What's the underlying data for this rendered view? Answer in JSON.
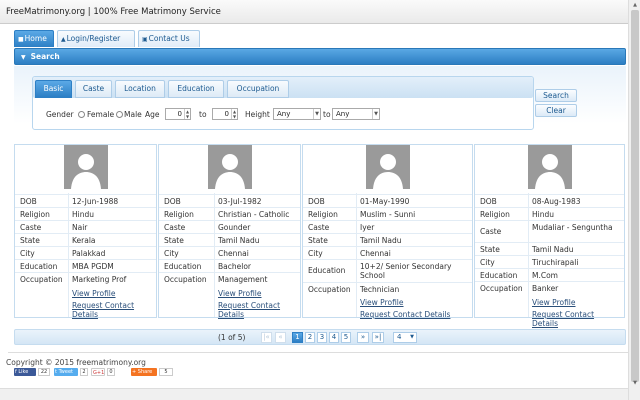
{
  "site": {
    "title": "FreeMatrimony.org | 100% Free Matrimony Service"
  },
  "nav": {
    "tabs": [
      {
        "label": "Home",
        "icon": "home-icon"
      },
      {
        "label": "Login/Register",
        "icon": "lock-icon"
      },
      {
        "label": "Contact Us",
        "icon": "mail-icon"
      }
    ]
  },
  "search": {
    "header": "Search",
    "tabs": [
      "Basic",
      "Caste",
      "Location",
      "Education",
      "Occupation"
    ],
    "gender_label": "Gender",
    "female_label": "Female",
    "male_label": "Male",
    "age_label": "Age",
    "age_from": "0",
    "age_to_label": "to",
    "age_to": "0",
    "height_label": "Height",
    "height_from": "Any",
    "height_to_label": "to",
    "height_to": "Any",
    "search_button": "Search",
    "clear_button": "Clear"
  },
  "profile_labels": {
    "dob": "DOB",
    "religion": "Religion",
    "caste": "Caste",
    "state": "State",
    "city": "City",
    "education": "Education",
    "occupation": "Occupation",
    "view_profile": "View Profile",
    "request_contact": "Request Contact Details"
  },
  "profiles": [
    {
      "dob": "12-Jun-1988",
      "religion": "Hindu",
      "caste": "Nair",
      "state": "Kerala",
      "city": "Palakkad",
      "education": "MBA PGDM",
      "occupation": "Marketing Prof"
    },
    {
      "dob": "03-Jul-1982",
      "religion": "Christian - Catholic",
      "caste": "Gounder",
      "state": "Tamil Nadu",
      "city": "Chennai",
      "education": "Bachelor",
      "occupation": "Management"
    },
    {
      "dob": "01-May-1990",
      "religion": "Muslim - Sunni",
      "caste": "Iyer",
      "state": "Tamil Nadu",
      "city": "Chennai",
      "education": "10+2/ Senior Secondary School",
      "occupation": "Technician"
    },
    {
      "dob": "08-Aug-1983",
      "religion": "Hindu",
      "caste": "Mudaliar - Senguntha",
      "state": "Tamil Nadu",
      "city": "Tiruchirapali",
      "education": "M.Com",
      "occupation": "Banker"
    }
  ],
  "pager": {
    "info": "(1 of 5)",
    "pages": [
      "1",
      "2",
      "3",
      "4",
      "5"
    ],
    "current_page": "1",
    "first": "|«",
    "prev": "«",
    "next": "»",
    "last": "»|",
    "rows_per_page": "4"
  },
  "footer": {
    "copyright": "Copyright © 2015 freematrimony.org",
    "fb_label": "Like",
    "fb_count": "22",
    "tweet_label": "Tweet",
    "tweet_count": "2",
    "gplus_label": "G+1",
    "gplus_count": "0",
    "share_label": "Share",
    "share_count": "5"
  },
  "colors": {
    "accent": "#2d7fc5",
    "link": "#2a4f7a",
    "avatar": "#9a9a9a"
  }
}
